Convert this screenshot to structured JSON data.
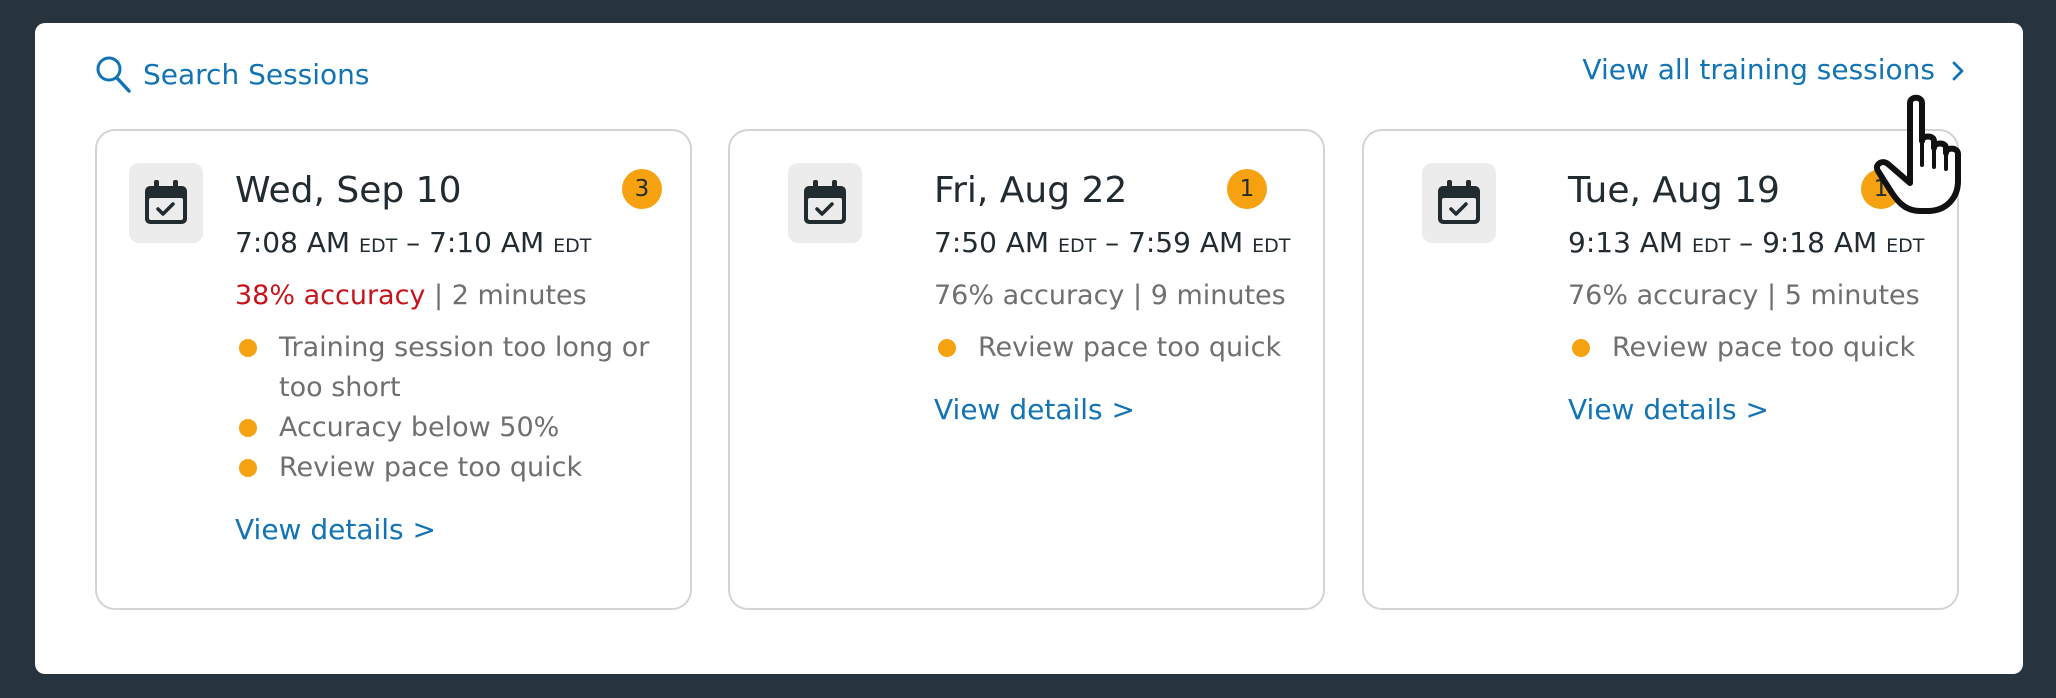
{
  "header": {
    "search_label": "Search Sessions",
    "view_all_label": "View all training sessions"
  },
  "sessions": [
    {
      "date": "Wed, Sep 10",
      "badge_count": "3",
      "start_time": "7:08 AM",
      "start_tz": "EDT",
      "separator": " – ",
      "end_time": "7:10 AM",
      "end_tz": "EDT",
      "accuracy": "38% accuracy",
      "accuracy_bad": true,
      "stats_sep": " | ",
      "duration": "2 minutes",
      "flags": [
        "Training session too long or too short",
        "Accuracy below 50%",
        "Review pace too quick"
      ],
      "details_label": "View details >"
    },
    {
      "date": "Fri, Aug 22",
      "badge_count": "1",
      "start_time": "7:50 AM",
      "start_tz": "EDT",
      "separator": " – ",
      "end_time": "7:59 AM",
      "end_tz": "EDT",
      "accuracy": "76% accuracy",
      "accuracy_bad": false,
      "stats_sep": " | ",
      "duration": "9 minutes",
      "flags": [
        "Review pace too quick"
      ],
      "details_label": "View details >"
    },
    {
      "date": "Tue, Aug 19",
      "badge_count": "1",
      "start_time": "9:13 AM",
      "start_tz": "EDT",
      "separator": " – ",
      "end_time": "9:18 AM",
      "end_tz": "EDT",
      "accuracy": "76% accuracy",
      "accuracy_bad": false,
      "stats_sep": " | ",
      "duration": "5 minutes",
      "flags": [
        "Review pace too quick"
      ],
      "details_label": "View details >"
    }
  ],
  "icons": {
    "search": "search-icon",
    "chevron": "chevron-right-icon",
    "calendar": "calendar-check-icon",
    "cursor": "hand-pointer-cursor-icon"
  },
  "colors": {
    "background": "#27343d",
    "link": "#1273b5",
    "badge": "#f6a210",
    "error": "#c8131b",
    "muted": "#6f6f6f"
  }
}
